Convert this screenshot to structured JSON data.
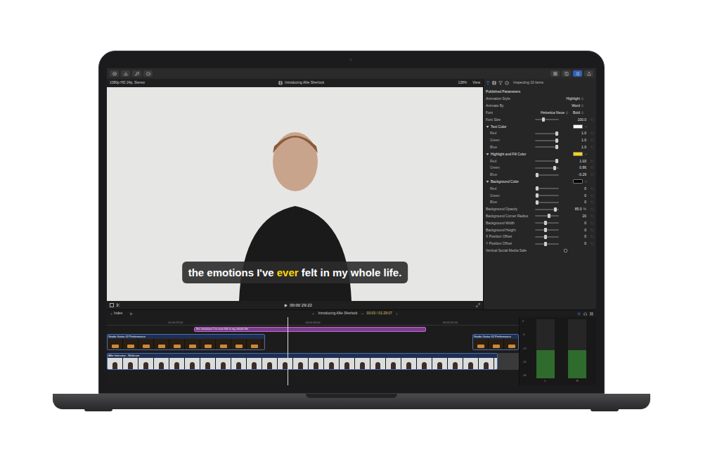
{
  "viewer": {
    "format": "1080p HD 24p, Stereo",
    "title": "Introducing Allie Sherlock",
    "zoom": "138%",
    "view_menu": "View",
    "timecode": "00:00 29:22",
    "caption": [
      {
        "text": "the emotions I've ",
        "highlighted": false
      },
      {
        "text": "ever",
        "highlighted": true
      },
      {
        "text": " felt in my whole life.",
        "highlighted": false
      }
    ]
  },
  "inspector": {
    "header": "Inspecting 10 items",
    "section": "Published Parameters",
    "rows": [
      {
        "kind": "popup",
        "label": "Animation Style",
        "value": "Highlight"
      },
      {
        "kind": "popup",
        "label": "Animate By",
        "value": "Word"
      },
      {
        "kind": "font",
        "label": "Font",
        "value": "Helvetica Neue",
        "style": "Bold"
      },
      {
        "kind": "slider",
        "label": "Font Size",
        "value": "100.0",
        "level": 0.35
      },
      {
        "kind": "color",
        "label": "Text Color",
        "expanded": true,
        "color": "#ffffff"
      },
      {
        "kind": "channel",
        "label": "Red",
        "value": "1.0",
        "level": 0.9
      },
      {
        "kind": "channel",
        "label": "Green",
        "value": "1.0",
        "level": 0.9
      },
      {
        "kind": "channel",
        "label": "Blue",
        "value": "1.0",
        "level": 0.9
      },
      {
        "kind": "color",
        "label": "Highlight and Fill Color",
        "expanded": true,
        "color": "#ffd60a"
      },
      {
        "kind": "channel",
        "label": "Red",
        "value": "1.03",
        "level": 0.92
      },
      {
        "kind": "channel",
        "label": "Green",
        "value": "0.86",
        "level": 0.82
      },
      {
        "kind": "channel",
        "label": "Blue",
        "value": "-0.29",
        "level": 0.1
      },
      {
        "kind": "color",
        "label": "Background Color",
        "expanded": true,
        "color": "#000000"
      },
      {
        "kind": "channel",
        "label": "Red",
        "value": "0",
        "level": 0.1
      },
      {
        "kind": "channel",
        "label": "Green",
        "value": "0",
        "level": 0.1
      },
      {
        "kind": "channel",
        "label": "Blue",
        "value": "0",
        "level": 0.1
      },
      {
        "kind": "slider",
        "label": "Background Opacity",
        "value": "85.0",
        "unit": "%",
        "level": 0.85
      },
      {
        "kind": "slider",
        "label": "Background Corner Radius",
        "value": "20",
        "level": 0.6
      },
      {
        "kind": "slider",
        "label": "Background Width",
        "value": "0",
        "level": 0.45
      },
      {
        "kind": "slider",
        "label": "Background Height",
        "value": "0",
        "level": 0.45
      },
      {
        "kind": "slider",
        "label": "X Position Offset",
        "value": "0",
        "level": 0.45
      },
      {
        "kind": "slider",
        "label": "Y Position Offset",
        "value": "0",
        "level": 0.45
      },
      {
        "kind": "checkbox",
        "label": "Vertical Social Media Safe",
        "checked": false
      }
    ]
  },
  "timeline": {
    "index": "Index",
    "project": "Introducing Allie Sherlock",
    "duration": "00:03 / 01:29:07",
    "ruler": [
      "00:00:29:00",
      "00:00:30:00",
      "00:00:31:00"
    ],
    "title_clip": {
      "name": "the emotions I've ever felt in my whole life"
    },
    "music_clips": [
      {
        "name": "Studio Guitar 02 Performance"
      },
      {
        "name": "Studio Guitar 02 Performance"
      }
    ],
    "video_clip": {
      "name": "Allie Interview - Multicam"
    }
  },
  "meter": {
    "scale": [
      "0",
      "-6",
      "-12",
      "-20",
      "-30"
    ],
    "channels": [
      {
        "name": "L",
        "level": 0.48
      },
      {
        "name": "R",
        "level": 0.48
      }
    ]
  }
}
